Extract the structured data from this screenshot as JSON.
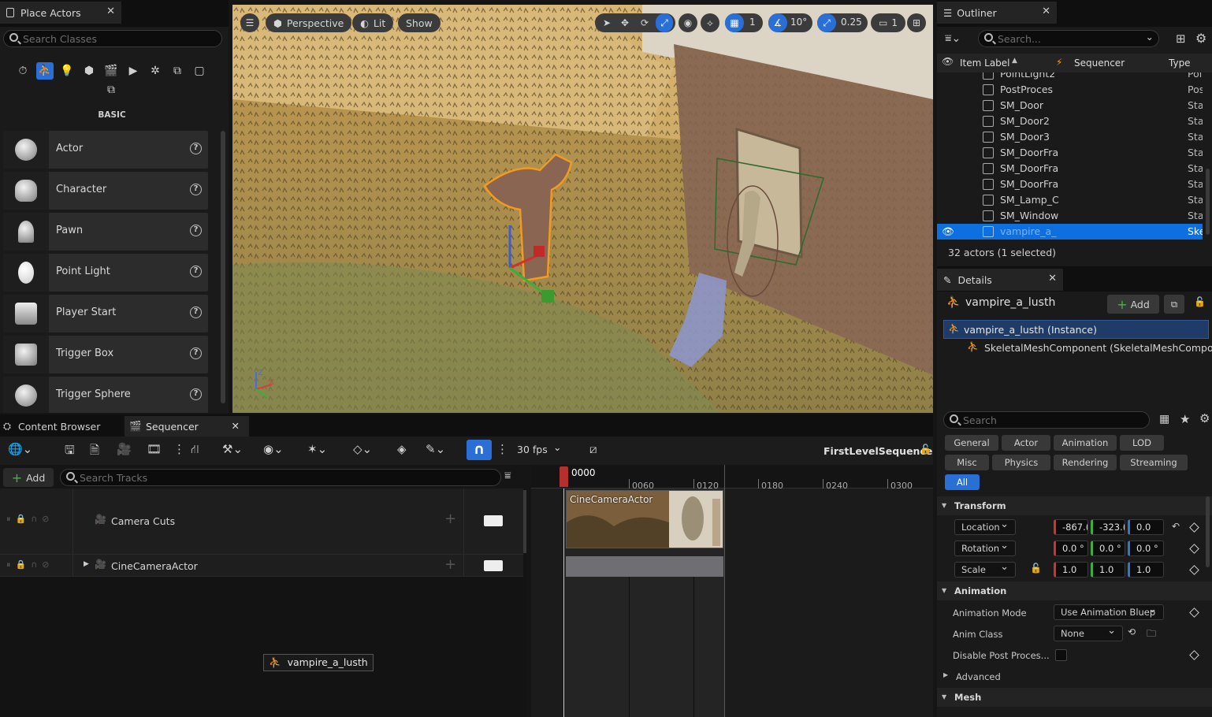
{
  "place_actors": {
    "tab_title": "Place Actors",
    "search_placeholder": "Search Classes",
    "category_label": "BASIC",
    "items": [
      {
        "label": "Actor",
        "icon": "sphere-icon"
      },
      {
        "label": "Character",
        "icon": "character-icon"
      },
      {
        "label": "Pawn",
        "icon": "pawn-icon"
      },
      {
        "label": "Point Light",
        "icon": "light-bulb-icon"
      },
      {
        "label": "Player Start",
        "icon": "player-start-icon"
      },
      {
        "label": "Trigger Box",
        "icon": "trigger-box-icon"
      },
      {
        "label": "Trigger Sphere",
        "icon": "trigger-sphere-icon"
      }
    ]
  },
  "viewport": {
    "perspective_label": "Perspective",
    "lit_label": "Lit",
    "show_label": "Show",
    "grid_snap_value": "1",
    "rotation_snap_value": "10°",
    "scale_snap_value": "0.25",
    "camera_speed_value": "1"
  },
  "outliner": {
    "tab_title": "Outliner",
    "search_placeholder": "Search...",
    "col_item_label": "Item Label",
    "col_sequencer": "Sequencer",
    "col_type": "Type",
    "rows": [
      {
        "label": "PointLight2",
        "type": "PointLi"
      },
      {
        "label": "PostProces",
        "type": "PostPro"
      },
      {
        "label": "SM_Door",
        "type": "StaticM"
      },
      {
        "label": "SM_Door2",
        "type": "StaticM"
      },
      {
        "label": "SM_Door3",
        "type": "StaticM"
      },
      {
        "label": "SM_DoorFra",
        "type": "StaticM"
      },
      {
        "label": "SM_DoorFra",
        "type": "StaticM"
      },
      {
        "label": "SM_DoorFra",
        "type": "StaticM"
      },
      {
        "label": "SM_Lamp_C",
        "type": "StaticM"
      },
      {
        "label": "SM_Window",
        "type": "StaticM"
      }
    ],
    "selected_row": {
      "label": "vampire_a_",
      "type": "Skeleta"
    },
    "status": "32 actors (1 selected)"
  },
  "details": {
    "tab_title": "Details",
    "actor_name": "vampire_a_lusth",
    "add_label": "Add",
    "instance_label": "vampire_a_lusth (Instance)",
    "component_label": "SkeletalMeshComponent (SkeletalMeshComponent)",
    "search_placeholder": "Search",
    "filters_row1": [
      "General",
      "Actor",
      "Animation",
      "LOD"
    ],
    "filters_row2": [
      "Misc",
      "Physics",
      "Rendering",
      "Streaming"
    ],
    "filter_all": "All",
    "transform_section": "Transform",
    "location_label": "Location",
    "location": [
      "-867.(",
      "-323.(",
      "0.0"
    ],
    "rotation_label": "Rotation",
    "rotation": [
      "0.0 °",
      "0.0 °",
      "0.0 °"
    ],
    "scale_label": "Scale",
    "scale": [
      "1.0",
      "1.0",
      "1.0"
    ],
    "animation_section": "Animation",
    "animation_mode_label": "Animation Mode",
    "animation_mode_value": "Use Animation Bluep",
    "anim_class_label": "Anim Class",
    "anim_class_value": "None",
    "disable_post_label": "Disable Post Proces...",
    "advanced_label": "Advanced",
    "mesh_section": "Mesh"
  },
  "bottom_tabs": {
    "content_browser": "Content Browser",
    "sequencer": "Sequencer"
  },
  "sequencer": {
    "fps_label": "30 fps",
    "sequence_name": "FirstLevelSequence",
    "add_label": "Add",
    "search_placeholder": "Search Tracks",
    "current_frame": "0000",
    "ticks": [
      "0060",
      "0120",
      "0180",
      "0240",
      "0300"
    ],
    "tracks": [
      {
        "label": "Camera Cuts"
      },
      {
        "label": "CineCameraActor"
      }
    ],
    "clip_label": "CineCameraActor",
    "drag_label": "vampire_a_lusth"
  }
}
